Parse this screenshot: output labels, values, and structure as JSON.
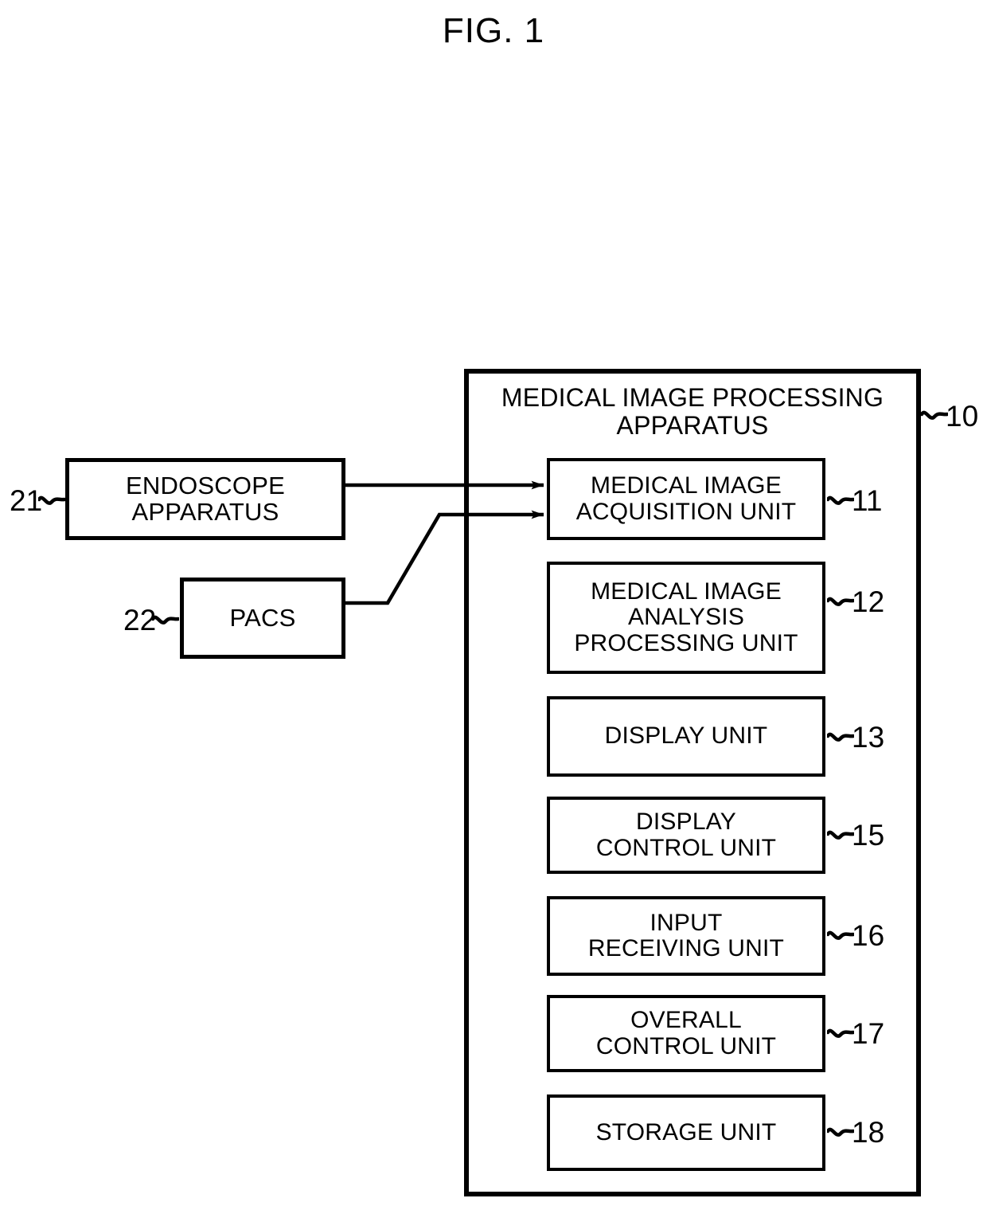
{
  "figure": {
    "title": "FIG. 1"
  },
  "apparatus": {
    "title": "MEDICAL IMAGE PROCESSING\nAPPARATUS",
    "ref": "10",
    "units": [
      {
        "label": "MEDICAL IMAGE\nACQUISITION UNIT",
        "ref": "11"
      },
      {
        "label": "MEDICAL IMAGE\nANALYSIS\nPROCESSING UNIT",
        "ref": "12"
      },
      {
        "label": "DISPLAY UNIT",
        "ref": "13"
      },
      {
        "label": "DISPLAY\nCONTROL UNIT",
        "ref": "15"
      },
      {
        "label": "INPUT\nRECEIVING UNIT",
        "ref": "16"
      },
      {
        "label": "OVERALL\nCONTROL UNIT",
        "ref": "17"
      },
      {
        "label": "STORAGE UNIT",
        "ref": "18"
      }
    ]
  },
  "external": [
    {
      "label": "ENDOSCOPE\nAPPARATUS",
      "ref": "21"
    },
    {
      "label": "PACS",
      "ref": "22"
    }
  ],
  "connections": [
    {
      "from": "21",
      "to": "11",
      "arrow": "arrowhead-right"
    },
    {
      "from": "22",
      "to": "11",
      "arrow": "arrowhead-right"
    }
  ],
  "colors": {
    "stroke": "#000000",
    "background": "#ffffff"
  }
}
